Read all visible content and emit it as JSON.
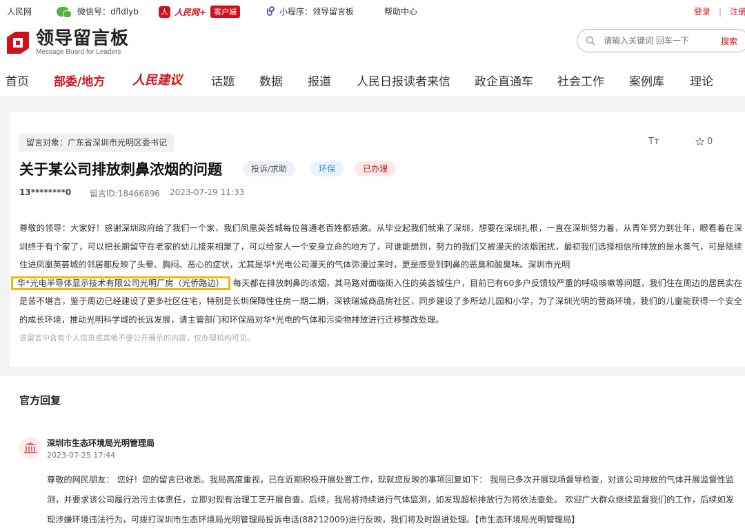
{
  "topbar": {
    "site": "人民网",
    "wechat": "微信号：dfldlyb",
    "rmw_logo": "人民网+",
    "client_badge": "客户端",
    "miniprogram": "小程序：领导留言板",
    "help": "帮助中心",
    "login": "登录",
    "separator": "|",
    "register": "注册"
  },
  "header": {
    "logo_title": "领导留言板",
    "logo_subtitle": "Message Board for Leaders",
    "search_placeholder": "请输入关键词 回车一下",
    "search_button": "搜索"
  },
  "nav": {
    "items": [
      "首页",
      "部委/地方",
      "人民建议",
      "话题",
      "数据",
      "报道",
      "人民日报读者来信",
      "政企直通车",
      "社会工作",
      "案例库",
      "理论"
    ]
  },
  "message": {
    "recipient": "留言对象：广东省深圳市光明区委书记",
    "font_tool": "Tт",
    "favorite_count": "0",
    "title": "关于某公司排放刺鼻浓烟的问题",
    "tags": [
      "投诉/求助",
      "环保",
      "已办理"
    ],
    "author": "13********0",
    "message_id": "留言ID:18466896",
    "datetime": "2023-07-19 11:33",
    "body_part1": "尊敬的领导：大家好！感谢深圳政府给了我们一个家，我们凤凰英荟城每位普通老百姓都感激。从毕业起我们就来了深圳，想要在深圳扎根，一直在深圳努力着，从青年努力到壮年，眼看着在深圳终于有个家了，可以把长期留守在老家的幼儿接来相聚了，可以给家人一个安身立命的地方了，可谁能想到，努力的我们又被漫天的浓烟困扰，最初我们选择相信所排放的是水蒸气，可是陆续住进凤凰英荟城的邻居都反映了头晕、胸闷、恶心的症状，尤其是华*光电公司漫天的气体弥漫过来时，更是感受到刺鼻的恶臭和酸臭味。深圳市光明",
    "body_highlight": "华*光电半导体显示技术有限公司光明厂房（光侨路边）",
    "body_part2": "每天都在排放刺鼻的浓烟，其马路对面临街入住的英荟城住户，目前已有60多户反馈较严重的呼吸咳嗽等问题，我们住在周边的居民实在是苦不堪言，鉴于周边已经建设了更多社区住宅，特别是长圳保障性住房一期二期，深铁瑞城商品房社区，同步建设了多所幼儿园和小学，为了深圳光明的营商环境，我们的儿童能获得一个安全的成长环境，推动光明科学城的长远发展，请主管部门和环保局对华*光电的气体和污染物排放进行迁移整改处理。",
    "privacy_notice": "该留言中含有个人信息或其他不便公开展示的内容，仅办理机构可见。"
  },
  "reply": {
    "heading": "官方回复",
    "org_name": "深圳市生态环境局光明管理局",
    "date": "2023-07-25 17:44",
    "body": "尊敬的网民朋友：  您好！您的留言已收悉。我局高度重视，已在近期积极开展处置工作，现就您反映的事项回复如下：  我局已多次开展现场督导检查，对该公司排放的气体开展监督性监测，并要求该公司履行治污主体责任，立即对现有治理工艺开展自查。后续，我局将持续进行气体监测，如发现超标排放行为将依法查处。  欢迎广大群众继续监督我们的工作，后续如发现涉嫌环境违法行为，可拨打深圳市生态环境局光明管理局投诉电话(88212009)进行反映，我们将及时跟进处理。【市生态环境局光明管理局】"
  },
  "colors": {
    "brand_red": "#d0111b",
    "highlight_border": "#f5b800"
  },
  "icons": {
    "wechat": "wechat-icon",
    "rmw": "rmw-app-icon",
    "miniprogram": "miniprogram-icon",
    "logo": "message-board-logo",
    "search": "search-icon",
    "star": "star-icon",
    "org": "government-building-icon"
  }
}
